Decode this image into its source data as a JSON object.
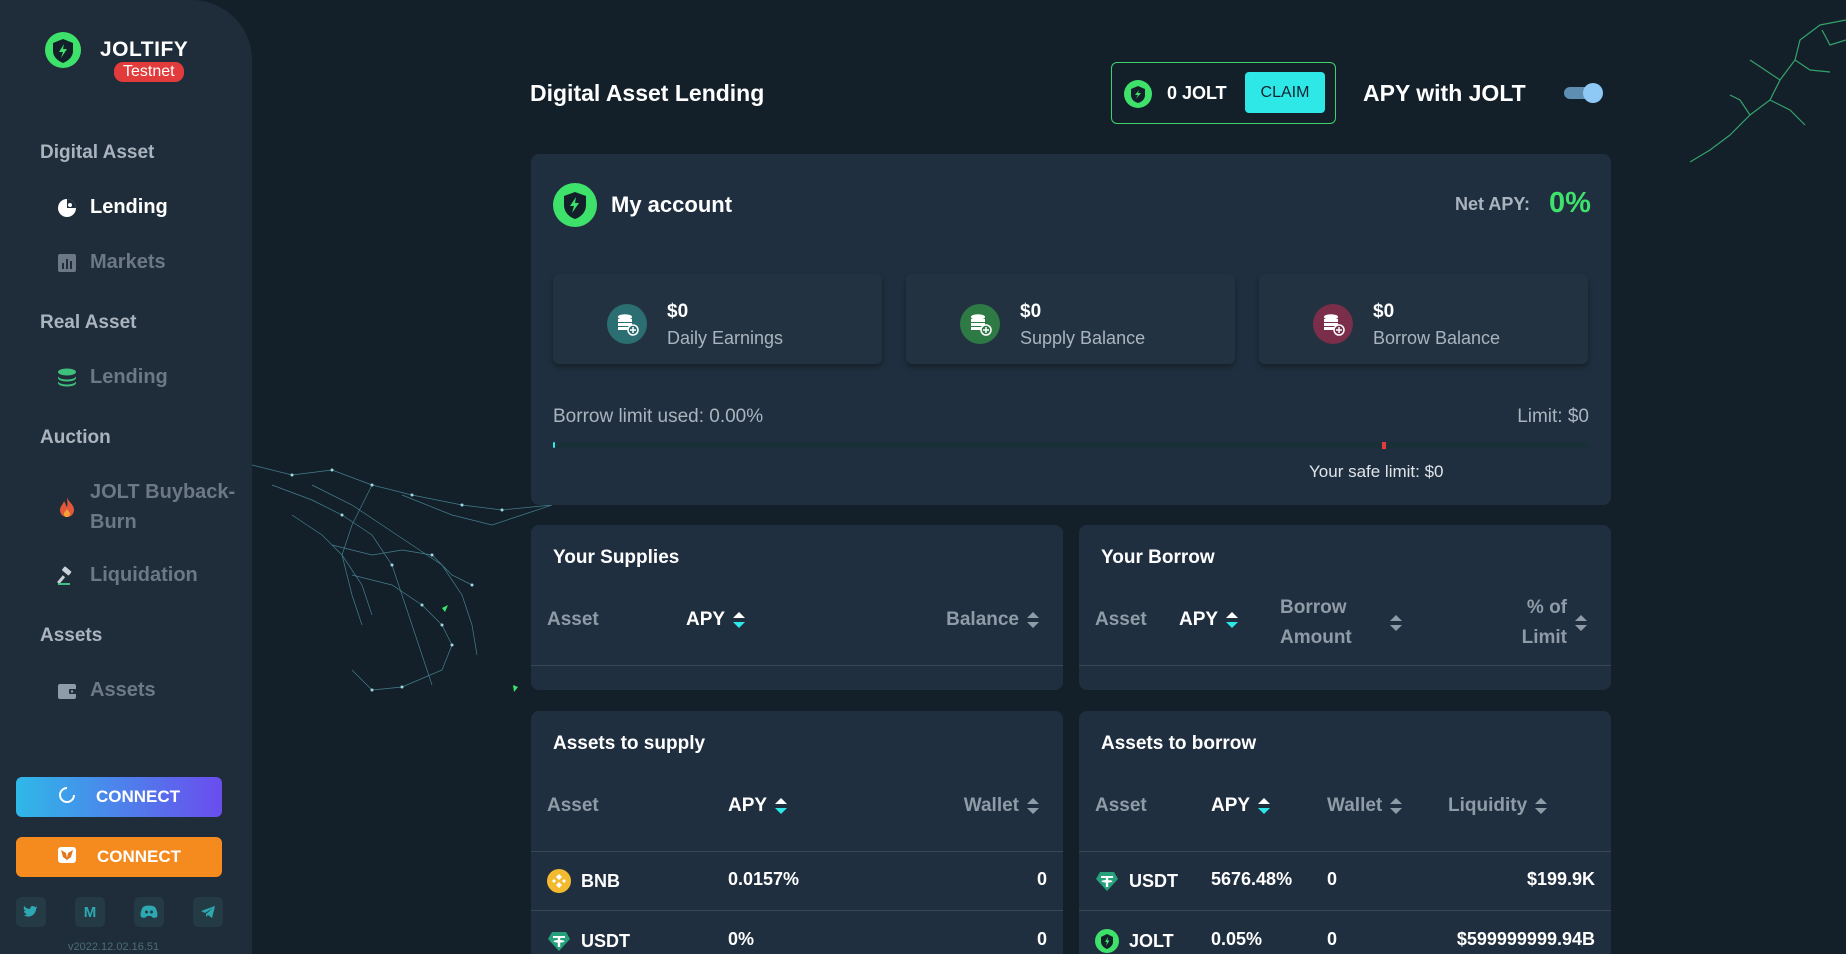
{
  "brand": {
    "name": "JOLTIFY",
    "badge": "Testnet"
  },
  "sidebar": {
    "sections": [
      {
        "title": "Digital Asset",
        "items": [
          {
            "label": "Lending",
            "icon": "pie-chart-icon",
            "active": true
          },
          {
            "label": "Markets",
            "icon": "bar-chart-icon"
          }
        ]
      },
      {
        "title": "Real Asset",
        "items": [
          {
            "label": "Lending",
            "icon": "coins-stack-icon"
          }
        ]
      },
      {
        "title": "Auction",
        "items": [
          {
            "label_line1": "JOLT Buyback-",
            "label_line2": "Burn",
            "icon": "flame-icon"
          },
          {
            "label": "Liquidation",
            "icon": "gavel-icon"
          }
        ]
      },
      {
        "title": "Assets",
        "items": [
          {
            "label": "Assets",
            "icon": "wallet-icon"
          }
        ]
      }
    ],
    "connect_walletconnect": "CONNECT",
    "connect_metamask": "CONNECT",
    "socials": [
      "twitter-icon",
      "medium-icon",
      "discord-icon",
      "telegram-icon"
    ],
    "version": "v2022.12.02.16.51"
  },
  "header": {
    "title": "Digital Asset Lending",
    "jolt_amount": "0 JOLT",
    "claim_label": "CLAIM",
    "apy_label": "APY with JOLT",
    "apy_toggle_on": true
  },
  "account": {
    "title": "My account",
    "net_apy_label": "Net APY:",
    "net_apy_value": "0%",
    "stats": [
      {
        "value": "$0",
        "label": "Daily Earnings",
        "color": "#2b7a7a"
      },
      {
        "value": "$0",
        "label": "Supply Balance",
        "color": "#2e8a4a"
      },
      {
        "value": "$0",
        "label": "Borrow Balance",
        "color": "#8a2e4e"
      }
    ],
    "borrow_used": "Borrow limit used: 0.00%",
    "limit": "Limit: $0",
    "borrow_used_fraction": 0.0,
    "safe_limit": "Your safe limit: $0"
  },
  "supplies": {
    "title": "Your Supplies",
    "headers": [
      "Asset",
      "APY",
      "Balance"
    ]
  },
  "borrow": {
    "title": "Your Borrow",
    "headers": [
      "Asset",
      "APY",
      "Borrow",
      "Amount",
      "% of",
      "Limit"
    ]
  },
  "assets_supply": {
    "title": "Assets to supply",
    "headers": [
      "Asset",
      "APY",
      "Wallet"
    ],
    "rows": [
      {
        "asset": "BNB",
        "apy": "0.0157%",
        "wallet": "0"
      },
      {
        "asset": "USDT",
        "apy": "0%",
        "wallet": "0"
      }
    ]
  },
  "assets_borrow": {
    "title": "Assets to borrow",
    "headers": [
      "Asset",
      "APY",
      "Wallet",
      "Liquidity"
    ],
    "rows": [
      {
        "asset": "USDT",
        "apy": "5676.48%",
        "wallet": "0",
        "liquidity": "$199.9K"
      },
      {
        "asset": "JOLT",
        "apy": "0.05%",
        "wallet": "0",
        "liquidity": "$599999999.94B"
      }
    ]
  },
  "colors": {
    "accent_cyan": "#2ee7e7",
    "accent_green": "#3ee26b",
    "danger": "#e23b3b",
    "panel": "#202f3f",
    "bg": "#13202a"
  }
}
